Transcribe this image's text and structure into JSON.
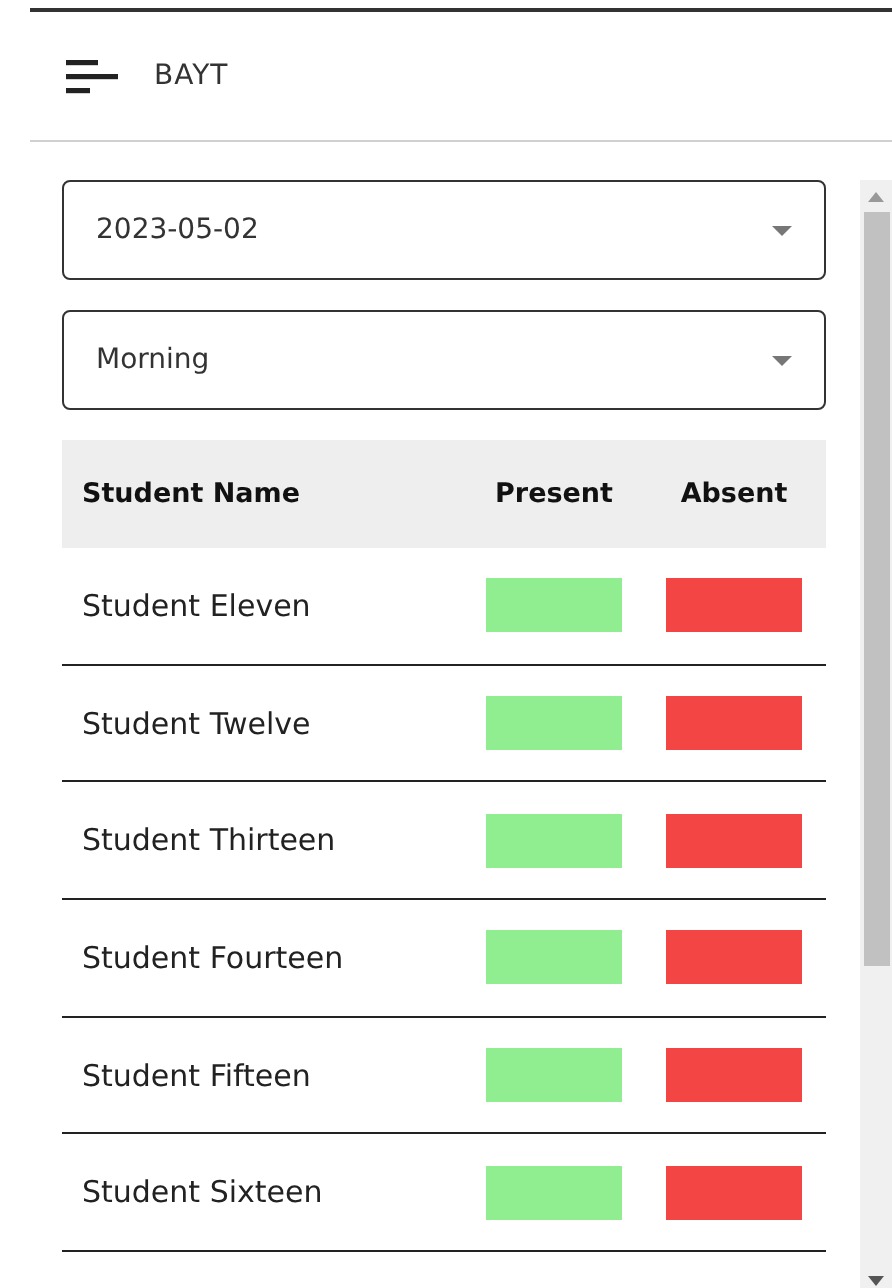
{
  "app_bar": {
    "title": "BAYT"
  },
  "filters": [
    {
      "value": "2023-05-02"
    },
    {
      "value": "Morning"
    }
  ],
  "table": {
    "columns": [
      "Student Name",
      "Present",
      "Absent"
    ],
    "rows": [
      {
        "name": "Student Eleven"
      },
      {
        "name": "Student Twelve"
      },
      {
        "name": "Student Thirteen"
      },
      {
        "name": "Student Fourteen"
      },
      {
        "name": "Student Fifteen"
      },
      {
        "name": "Student Sixteen"
      }
    ]
  }
}
